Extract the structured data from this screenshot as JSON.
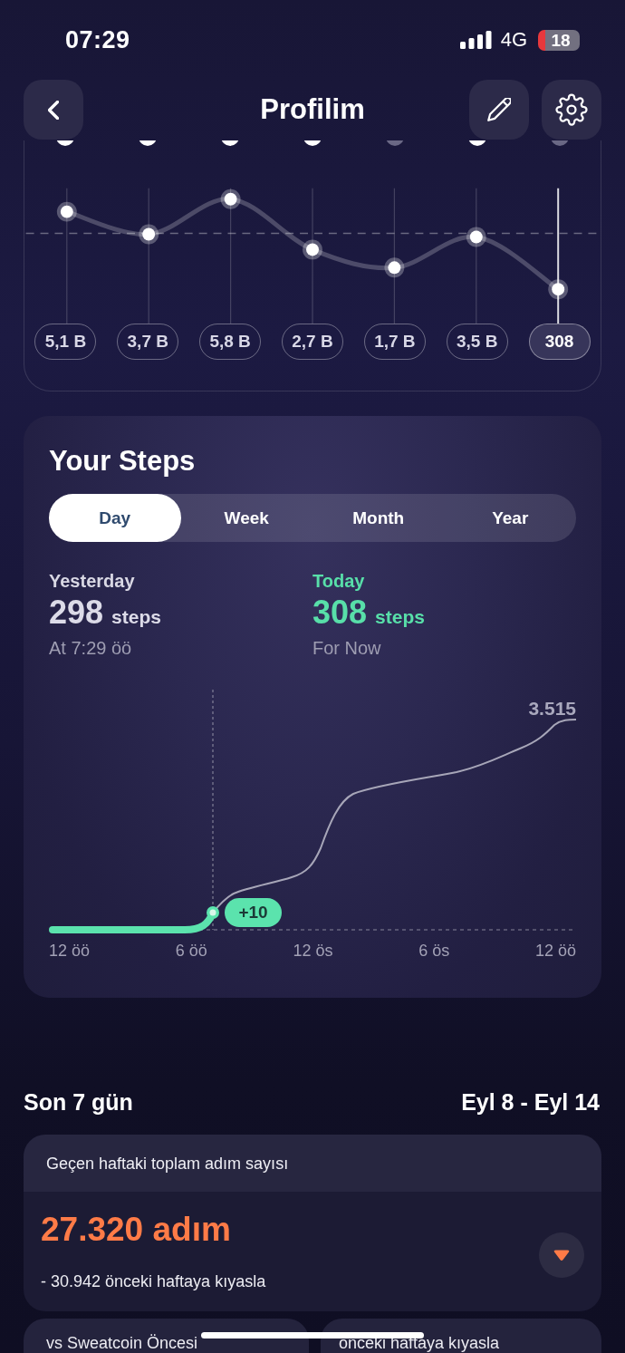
{
  "status_bar": {
    "time": "07:29",
    "network": "4G",
    "battery": "18"
  },
  "header": {
    "title": "Profilim"
  },
  "week_chart": {
    "day_markers": [
      {
        "active": true
      },
      {
        "active": true
      },
      {
        "active": true
      },
      {
        "active": true
      },
      {
        "active": false
      },
      {
        "active": true
      },
      {
        "active": false
      }
    ],
    "day_totals": [
      {
        "label": "5,1 B",
        "selected": false
      },
      {
        "label": "3,7 B",
        "selected": false
      },
      {
        "label": "5,8 B",
        "selected": false
      },
      {
        "label": "2,7 B",
        "selected": false
      },
      {
        "label": "1,7 B",
        "selected": false
      },
      {
        "label": "3,5 B",
        "selected": false
      },
      {
        "label": "308",
        "selected": true
      }
    ]
  },
  "steps_card": {
    "title": "Your Steps",
    "tabs": [
      {
        "label": "Day",
        "selected": true
      },
      {
        "label": "Week",
        "selected": false
      },
      {
        "label": "Month",
        "selected": false
      },
      {
        "label": "Year",
        "selected": false
      }
    ],
    "stats": [
      {
        "kind": "previous",
        "label": "Yesterday",
        "count": "298",
        "unit": "steps",
        "note": "At 7:29 öö"
      },
      {
        "kind": "current",
        "label": "Today",
        "count": "308",
        "unit": "steps",
        "note": "For Now"
      }
    ],
    "chart": {
      "end_label": "3.515",
      "now_badge": "+10",
      "x_labels": [
        "12 öö",
        "6 öö",
        "12 ös",
        "6 ös",
        "12 öö"
      ]
    }
  },
  "last_7_days": {
    "title": "Son 7 gün",
    "range": "Eyl 8 - Eyl 14",
    "summary_card": {
      "heading": "Geçen haftaki toplam adım sayısı",
      "total": "27.320 adım",
      "comparison": "- 30.942 önceki haftaya kıyasla",
      "decreased": true
    },
    "cards": [
      {
        "heading": "vs Sweatcoin Öncesi"
      },
      {
        "heading": "önceki haftaya kıyasla"
      }
    ]
  }
}
